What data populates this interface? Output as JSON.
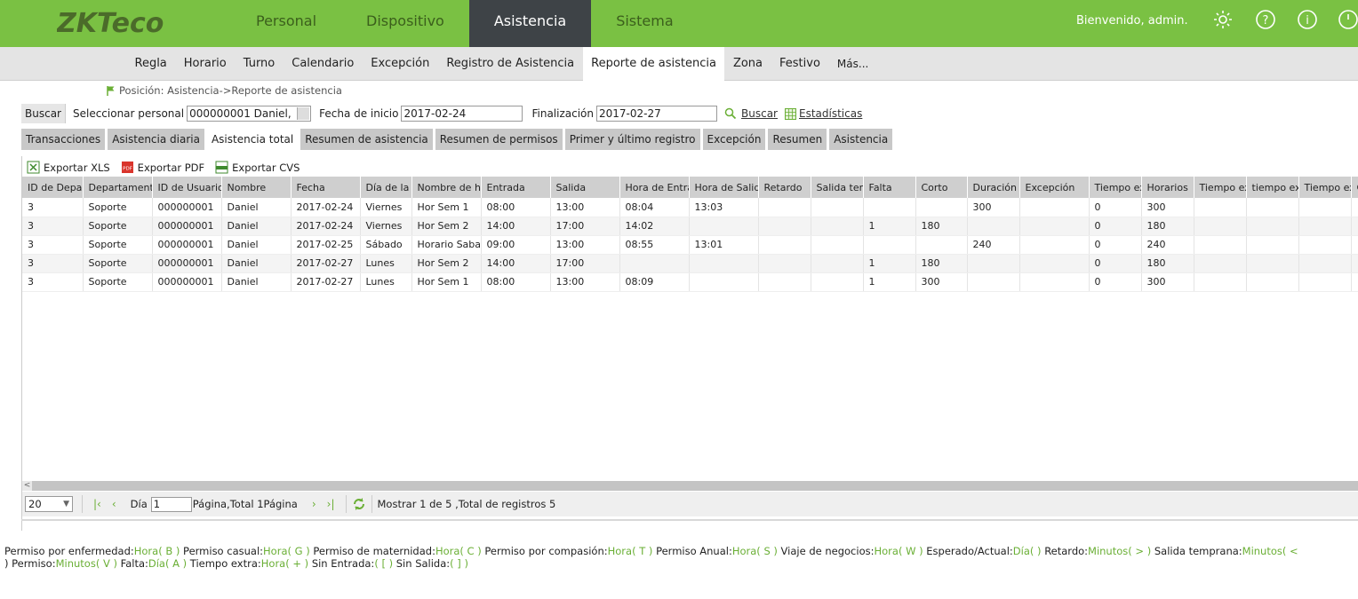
{
  "header": {
    "logo_text": "ZKTeco",
    "nav": [
      {
        "label": "Personal",
        "active": false
      },
      {
        "label": "Dispositivo",
        "active": false
      },
      {
        "label": "Asistencia",
        "active": true
      },
      {
        "label": "Sistema",
        "active": false
      }
    ],
    "welcome": "Bienvenido, admin.",
    "icons": [
      "gear-icon",
      "help-icon",
      "info-icon",
      "power-icon"
    ]
  },
  "subnav": [
    {
      "label": "Regla",
      "active": false
    },
    {
      "label": "Horario",
      "active": false
    },
    {
      "label": "Turno",
      "active": false
    },
    {
      "label": "Calendario",
      "active": false
    },
    {
      "label": "Excepción",
      "active": false
    },
    {
      "label": "Registro de Asistencia",
      "active": false
    },
    {
      "label": "Reporte de asistencia",
      "active": true
    },
    {
      "label": "Zona",
      "active": false
    },
    {
      "label": "Festivo",
      "active": false
    },
    {
      "label": "Más...",
      "active": false
    }
  ],
  "breadcrumb": "Posición: Asistencia->Reporte de asistencia",
  "search": {
    "tab_label": "Buscar",
    "person_label": "Seleccionar personal",
    "person_value": "000000001 Daniel,",
    "start_label": "Fecha de inicio",
    "start_value": "2017-02-24",
    "end_label": "Finalización",
    "end_value": "2017-02-27",
    "search_link": "Buscar",
    "stats_link": "Estadísticas"
  },
  "tabs": [
    {
      "label": "Transacciones",
      "active": false
    },
    {
      "label": "Asistencia diaria",
      "active": false
    },
    {
      "label": "Asistencia total",
      "active": true
    },
    {
      "label": "Resumen de asistencia",
      "active": false
    },
    {
      "label": "Resumen de permisos",
      "active": false
    },
    {
      "label": "Primer y último registro",
      "active": false
    },
    {
      "label": "Excepción",
      "active": false
    },
    {
      "label": "Resumen",
      "active": false
    },
    {
      "label": "Asistencia",
      "active": false
    }
  ],
  "exports": [
    "Exportar XLS",
    "Exportar PDF",
    "Exportar CVS"
  ],
  "table": {
    "columns": [
      "ID de Depar",
      "Departamento",
      "ID de Usuario",
      "Nombre",
      "Fecha",
      "Día de la s",
      "Nombre de ho",
      "Entrada",
      "Salida",
      "Hora de Entra",
      "Hora de Salida",
      "Retardo",
      "Salida tem",
      "Falta",
      "Corto",
      "Duración d",
      "Excepción",
      "Tiempo ex",
      "Horarios",
      "Tiempo ex",
      "tiempo ext",
      "Tiempo ex",
      "C"
    ],
    "rows": [
      [
        "3",
        "Soporte",
        "000000001",
        "Daniel",
        "2017-02-24",
        "Viernes",
        "Hor Sem 1",
        "08:00",
        "13:00",
        "08:04",
        "13:03",
        "",
        "",
        "",
        "",
        "300",
        "",
        "0",
        "300",
        "",
        "",
        "",
        ""
      ],
      [
        "3",
        "Soporte",
        "000000001",
        "Daniel",
        "2017-02-24",
        "Viernes",
        "Hor Sem 2",
        "14:00",
        "17:00",
        "14:02",
        "",
        "",
        "",
        "1",
        "180",
        "",
        "",
        "0",
        "180",
        "",
        "",
        "",
        ""
      ],
      [
        "3",
        "Soporte",
        "000000001",
        "Daniel",
        "2017-02-25",
        "Sábado",
        "Horario Sabad",
        "09:00",
        "13:00",
        "08:55",
        "13:01",
        "",
        "",
        "",
        "",
        "240",
        "",
        "0",
        "240",
        "",
        "",
        "",
        ""
      ],
      [
        "3",
        "Soporte",
        "000000001",
        "Daniel",
        "2017-02-27",
        "Lunes",
        "Hor Sem 2",
        "14:00",
        "17:00",
        "",
        "",
        "",
        "",
        "1",
        "180",
        "",
        "",
        "0",
        "180",
        "",
        "",
        "",
        ""
      ],
      [
        "3",
        "Soporte",
        "000000001",
        "Daniel",
        "2017-02-27",
        "Lunes",
        "Hor Sem 1",
        "08:00",
        "13:00",
        "08:09",
        "",
        "",
        "",
        "1",
        "300",
        "",
        "",
        "0",
        "300",
        "",
        "",
        "",
        ""
      ]
    ]
  },
  "pager": {
    "page_size": "20",
    "page_label": "Día",
    "page_value": "1",
    "page_total": "Página,Total 1Página",
    "records": "Mostrar 1 de 5 ,Total de registros 5"
  },
  "legend": {
    "line1": [
      {
        "k": "Permiso por enfermedad:",
        "v": "Hora( B )"
      },
      {
        "k": "Permiso casual:",
        "v": "Hora( G )"
      },
      {
        "k": "Permiso de maternidad:",
        "v": "Hora( C )"
      },
      {
        "k": "Permiso por compasión:",
        "v": "Hora( T )"
      },
      {
        "k": "Permiso Anual:",
        "v": "Hora( S )"
      },
      {
        "k": "Viaje de negocios:",
        "v": "Hora( W )"
      },
      {
        "k": "Esperado/Actual:",
        "v": "Día( )"
      },
      {
        "k": "Retardo:",
        "v": "Minutos( > )"
      },
      {
        "k": "Salida temprana:",
        "v": "Minutos( <"
      }
    ],
    "line2_prefix": ")",
    "line2": [
      {
        "k": "Permiso:",
        "v": "Minutos( V )"
      },
      {
        "k": "Falta:",
        "v": "Día( A )"
      },
      {
        "k": "Tiempo extra:",
        "v": "Hora( + )"
      },
      {
        "k": "Sin Entrada:",
        "v": "( [ )"
      },
      {
        "k": "Sin Salida:",
        "v": "( ] )"
      }
    ]
  },
  "colors": {
    "brand_green": "#7ac143",
    "active_nav": "#3e4347",
    "accent_green": "#6aaf35"
  }
}
